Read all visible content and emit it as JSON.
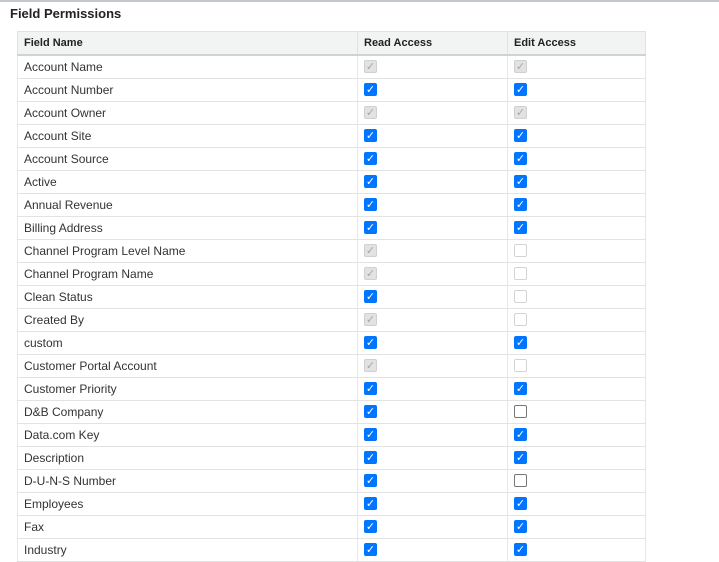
{
  "section": {
    "title": "Field Permissions"
  },
  "columns": {
    "field_name": "Field Name",
    "read_access": "Read Access",
    "edit_access": "Edit Access"
  },
  "rows": [
    {
      "field": "Account Name",
      "read": {
        "checked": true,
        "disabled": true
      },
      "edit": {
        "checked": true,
        "disabled": true
      }
    },
    {
      "field": "Account Number",
      "read": {
        "checked": true,
        "disabled": false
      },
      "edit": {
        "checked": true,
        "disabled": false
      }
    },
    {
      "field": "Account Owner",
      "read": {
        "checked": true,
        "disabled": true
      },
      "edit": {
        "checked": true,
        "disabled": true
      }
    },
    {
      "field": "Account Site",
      "read": {
        "checked": true,
        "disabled": false
      },
      "edit": {
        "checked": true,
        "disabled": false
      }
    },
    {
      "field": "Account Source",
      "read": {
        "checked": true,
        "disabled": false
      },
      "edit": {
        "checked": true,
        "disabled": false
      }
    },
    {
      "field": "Active",
      "read": {
        "checked": true,
        "disabled": false
      },
      "edit": {
        "checked": true,
        "disabled": false
      }
    },
    {
      "field": "Annual Revenue",
      "read": {
        "checked": true,
        "disabled": false
      },
      "edit": {
        "checked": true,
        "disabled": false
      }
    },
    {
      "field": "Billing Address",
      "read": {
        "checked": true,
        "disabled": false
      },
      "edit": {
        "checked": true,
        "disabled": false
      }
    },
    {
      "field": "Channel Program Level Name",
      "read": {
        "checked": true,
        "disabled": true
      },
      "edit": {
        "checked": false,
        "disabled": true
      }
    },
    {
      "field": "Channel Program Name",
      "read": {
        "checked": true,
        "disabled": true
      },
      "edit": {
        "checked": false,
        "disabled": true
      }
    },
    {
      "field": "Clean Status",
      "read": {
        "checked": true,
        "disabled": false
      },
      "edit": {
        "checked": false,
        "disabled": true
      }
    },
    {
      "field": "Created By",
      "read": {
        "checked": true,
        "disabled": true
      },
      "edit": {
        "checked": false,
        "disabled": true
      }
    },
    {
      "field": "custom",
      "read": {
        "checked": true,
        "disabled": false
      },
      "edit": {
        "checked": true,
        "disabled": false
      }
    },
    {
      "field": "Customer Portal Account",
      "read": {
        "checked": true,
        "disabled": true
      },
      "edit": {
        "checked": false,
        "disabled": true
      }
    },
    {
      "field": "Customer Priority",
      "read": {
        "checked": true,
        "disabled": false
      },
      "edit": {
        "checked": true,
        "disabled": false
      }
    },
    {
      "field": "D&B Company",
      "read": {
        "checked": true,
        "disabled": false
      },
      "edit": {
        "checked": false,
        "disabled": false
      }
    },
    {
      "field": "Data.com Key",
      "read": {
        "checked": true,
        "disabled": false
      },
      "edit": {
        "checked": true,
        "disabled": false
      }
    },
    {
      "field": "Description",
      "read": {
        "checked": true,
        "disabled": false
      },
      "edit": {
        "checked": true,
        "disabled": false
      }
    },
    {
      "field": "D-U-N-S Number",
      "read": {
        "checked": true,
        "disabled": false
      },
      "edit": {
        "checked": false,
        "disabled": false
      }
    },
    {
      "field": "Employees",
      "read": {
        "checked": true,
        "disabled": false
      },
      "edit": {
        "checked": true,
        "disabled": false
      }
    },
    {
      "field": "Fax",
      "read": {
        "checked": true,
        "disabled": false
      },
      "edit": {
        "checked": true,
        "disabled": false
      }
    },
    {
      "field": "Industry",
      "read": {
        "checked": true,
        "disabled": false
      },
      "edit": {
        "checked": true,
        "disabled": false
      }
    }
  ],
  "colors": {
    "checkbox_checked": "#0075ff",
    "checkbox_disabled": "#e2e2e2",
    "header_background": "#f2f3f3",
    "row_divider": "#e3e3e3"
  },
  "icons": {
    "checked": "checkbox-checked-icon",
    "unchecked": "checkbox-unchecked-icon"
  }
}
